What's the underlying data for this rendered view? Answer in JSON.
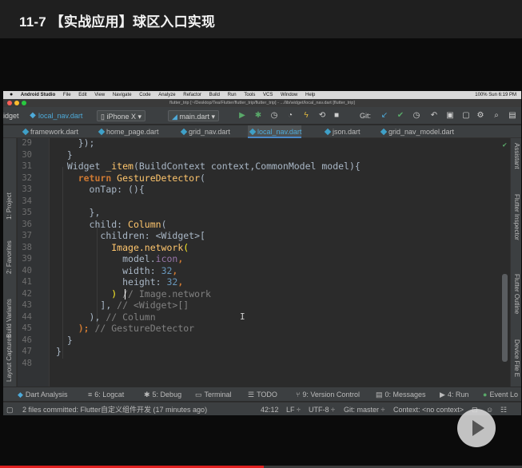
{
  "page": {
    "title": "11-7 【实战应用】球区入口实现"
  },
  "mac_menu": {
    "items": [
      "Android Studio",
      "File",
      "Edit",
      "View",
      "Navigate",
      "Code",
      "Analyze",
      "Refactor",
      "Build",
      "Run",
      "Tools",
      "VCS",
      "Window",
      "Help"
    ],
    "right_status": "100%  Sun 6:19 PM"
  },
  "window": {
    "path": "flutter_trip [~/Desktop/Tea/Flutter/flutter_trip/flutter_trip] - .../lib/widget/local_nav.dart [flutter_trip]"
  },
  "toolbar": {
    "widget_crumb": "idget",
    "file_crumb": "local_nav.dart",
    "device": "iPhone X",
    "run_config": "main.dart",
    "git_label": "Git:"
  },
  "tabs": [
    {
      "label": "framework.dart",
      "active": false
    },
    {
      "label": "home_page.dart",
      "active": false
    },
    {
      "label": "grid_nav.dart",
      "active": false
    },
    {
      "label": "local_nav.dart",
      "active": true
    },
    {
      "label": "json.dart",
      "active": false
    },
    {
      "label": "grid_nav_model.dart",
      "active": false
    }
  ],
  "left_tools": [
    "1: Project",
    "2: Favorites",
    "Build Variants",
    "Layout Captures"
  ],
  "right_tools": [
    "Assistant",
    "Flutter Inspector",
    "Flutter Outline",
    "Device File E"
  ],
  "editor": {
    "line_numbers": [
      "29",
      "30",
      "31",
      "32",
      "33",
      "34",
      "35",
      "36",
      "37",
      "38",
      "39",
      "40",
      "41",
      "42",
      "43",
      "44",
      "45",
      "46",
      "47",
      "48"
    ],
    "code": {
      "l29": "});",
      "l30": "}",
      "l31_a": "Widget ",
      "l31_b": "_item",
      "l31_c": "(BuildContext context,CommonModel model){",
      "l32_a": "return ",
      "l32_b": "GestureDetector",
      "l32_c": "(",
      "l33": "onTap: (){",
      "l35": "},",
      "l36_a": "child: ",
      "l36_b": "Column",
      "l36_c": "(",
      "l37": "children: <Widget>[",
      "l38_a": "Image.network",
      "l38_b": "(",
      "l39_a": "model.",
      "l39_b": "icon",
      "l39_c": ",",
      "l40_a": "width: ",
      "l40_b": "32",
      "l40_c": ",",
      "l41_a": "height: ",
      "l41_b": "32",
      "l41_c": ",",
      "l42_a": ")",
      "l42_b": " // Image.network",
      "l43_a": "], ",
      "l43_b": "// <Widget>[]",
      "l44_a": "), ",
      "l44_b": "// Column",
      "l45_a": "); ",
      "l45_b": "// GestureDetector",
      "l46": "}",
      "l47": "}"
    }
  },
  "bottom_tools": [
    {
      "label": "Dart Analysis",
      "icon": "dart-analysis-icon"
    },
    {
      "label": "6: Logcat",
      "icon": "logcat-icon"
    },
    {
      "label": "5: Debug",
      "icon": "debug-icon"
    },
    {
      "label": "Terminal",
      "icon": "terminal-icon"
    },
    {
      "label": "TODO",
      "icon": "todo-icon"
    },
    {
      "label": "9: Version Control",
      "icon": "version-control-icon"
    },
    {
      "label": "0: Messages",
      "icon": "messages-icon"
    },
    {
      "label": "4: Run",
      "icon": "run-icon"
    },
    {
      "label": "Event Lo",
      "icon": "event-log-icon"
    }
  ],
  "status": {
    "message": "2 files committed: Flutter自定义组件开发 (17 minutes ago)",
    "position": "42:12",
    "line_sep": "LF ÷",
    "encoding": "UTF-8 ÷",
    "git": "Git: master ÷",
    "context": "Context: <no context>"
  },
  "player": {
    "progress": 0.505
  },
  "colors": {
    "keyword": "#cc7832",
    "class": "#ffc66d",
    "field": "#9876aa",
    "number": "#6897bb",
    "comment": "#808080",
    "progress": "#e02020"
  }
}
